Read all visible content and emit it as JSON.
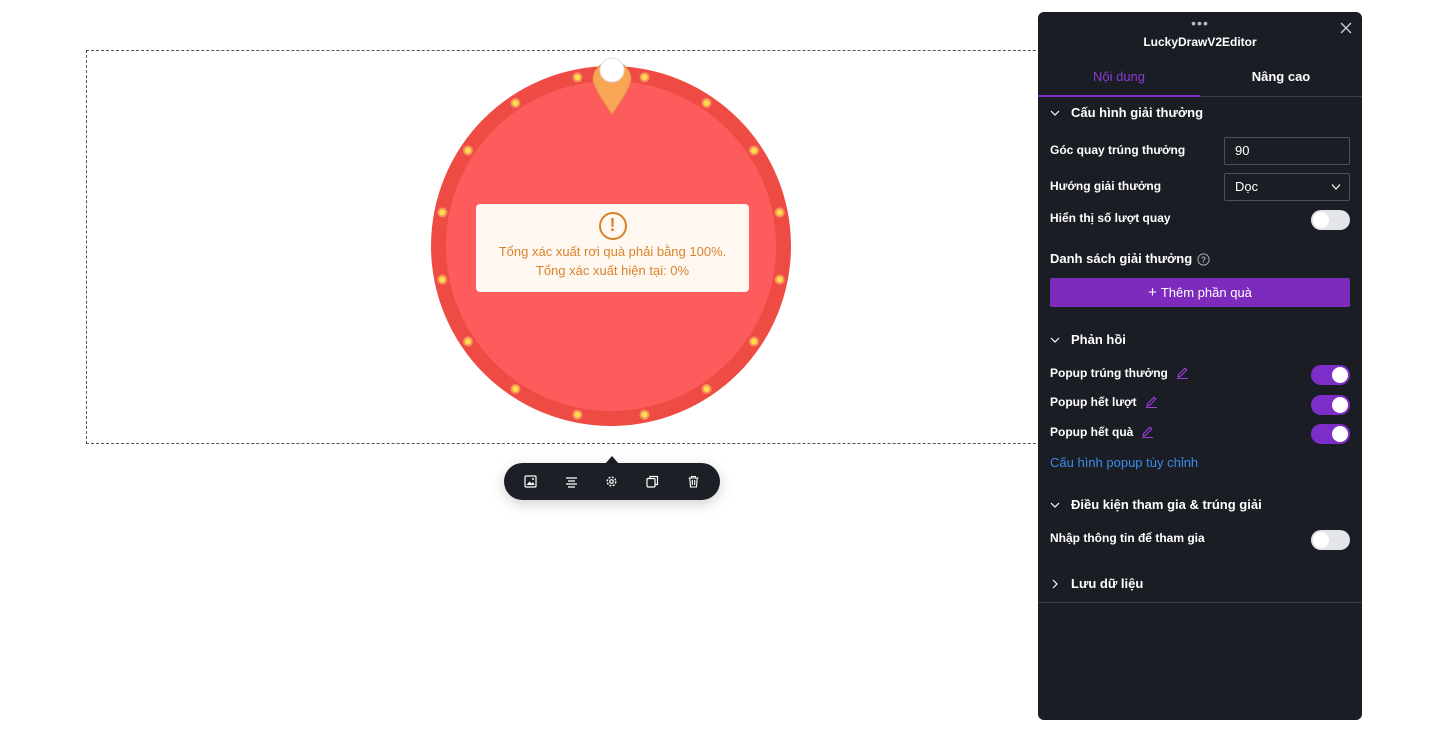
{
  "wheel": {
    "warning_icon": "exclamation-circle-icon",
    "warning_line1": "Tổng xác xuất rơi quà phải bằng 100%.",
    "warning_line2": "Tổng xác xuất hiện tại: 0%",
    "colors": {
      "outer_ring": "#ef4b45",
      "inner_face": "#fd5c5c",
      "bulbs": "#ffdd4a",
      "pointer": "#f9a556",
      "warning_text": "#d9822b"
    }
  },
  "toolbar": {
    "buttons": [
      {
        "name": "image-icon"
      },
      {
        "name": "align-center-icon"
      },
      {
        "name": "gear-icon"
      },
      {
        "name": "duplicate-icon"
      },
      {
        "name": "trash-icon"
      }
    ]
  },
  "panel": {
    "drag_handle": "•••",
    "title": "LuckyDrawV2Editor",
    "close_icon": "close-icon",
    "tabs": [
      {
        "label": "Nội dung",
        "active": true
      },
      {
        "label": "Nâng cao",
        "active": false
      }
    ],
    "prize_config": {
      "heading": "Cấu hình giải thưởng",
      "spin_angle_label": "Góc quay trúng thưởng",
      "spin_angle_value": "90",
      "direction_label": "Hướng giải thưởng",
      "direction_value": "Dọc",
      "show_spins_label": "Hiển thị số lượt quay",
      "show_spins_on": false,
      "list_label": "Danh sách giải thưởng",
      "add_button": "Thêm phần quà"
    },
    "feedback": {
      "heading": "Phản hồi",
      "items": [
        {
          "label": "Popup trúng thưởng",
          "on": true
        },
        {
          "label": "Popup hết lượt",
          "on": true
        },
        {
          "label": "Popup hết quà",
          "on": true
        }
      ],
      "custom_link": "Cấu hình popup tùy chỉnh"
    },
    "conditions": {
      "heading": "Điều kiện tham gia & trúng giải",
      "enter_info_label": "Nhập thông tin để tham gia",
      "enter_info_on": false
    },
    "save_data": {
      "heading": "Lưu dữ liệu"
    },
    "accent_color": "#7d2ec9",
    "link_color": "#3b8beb"
  }
}
